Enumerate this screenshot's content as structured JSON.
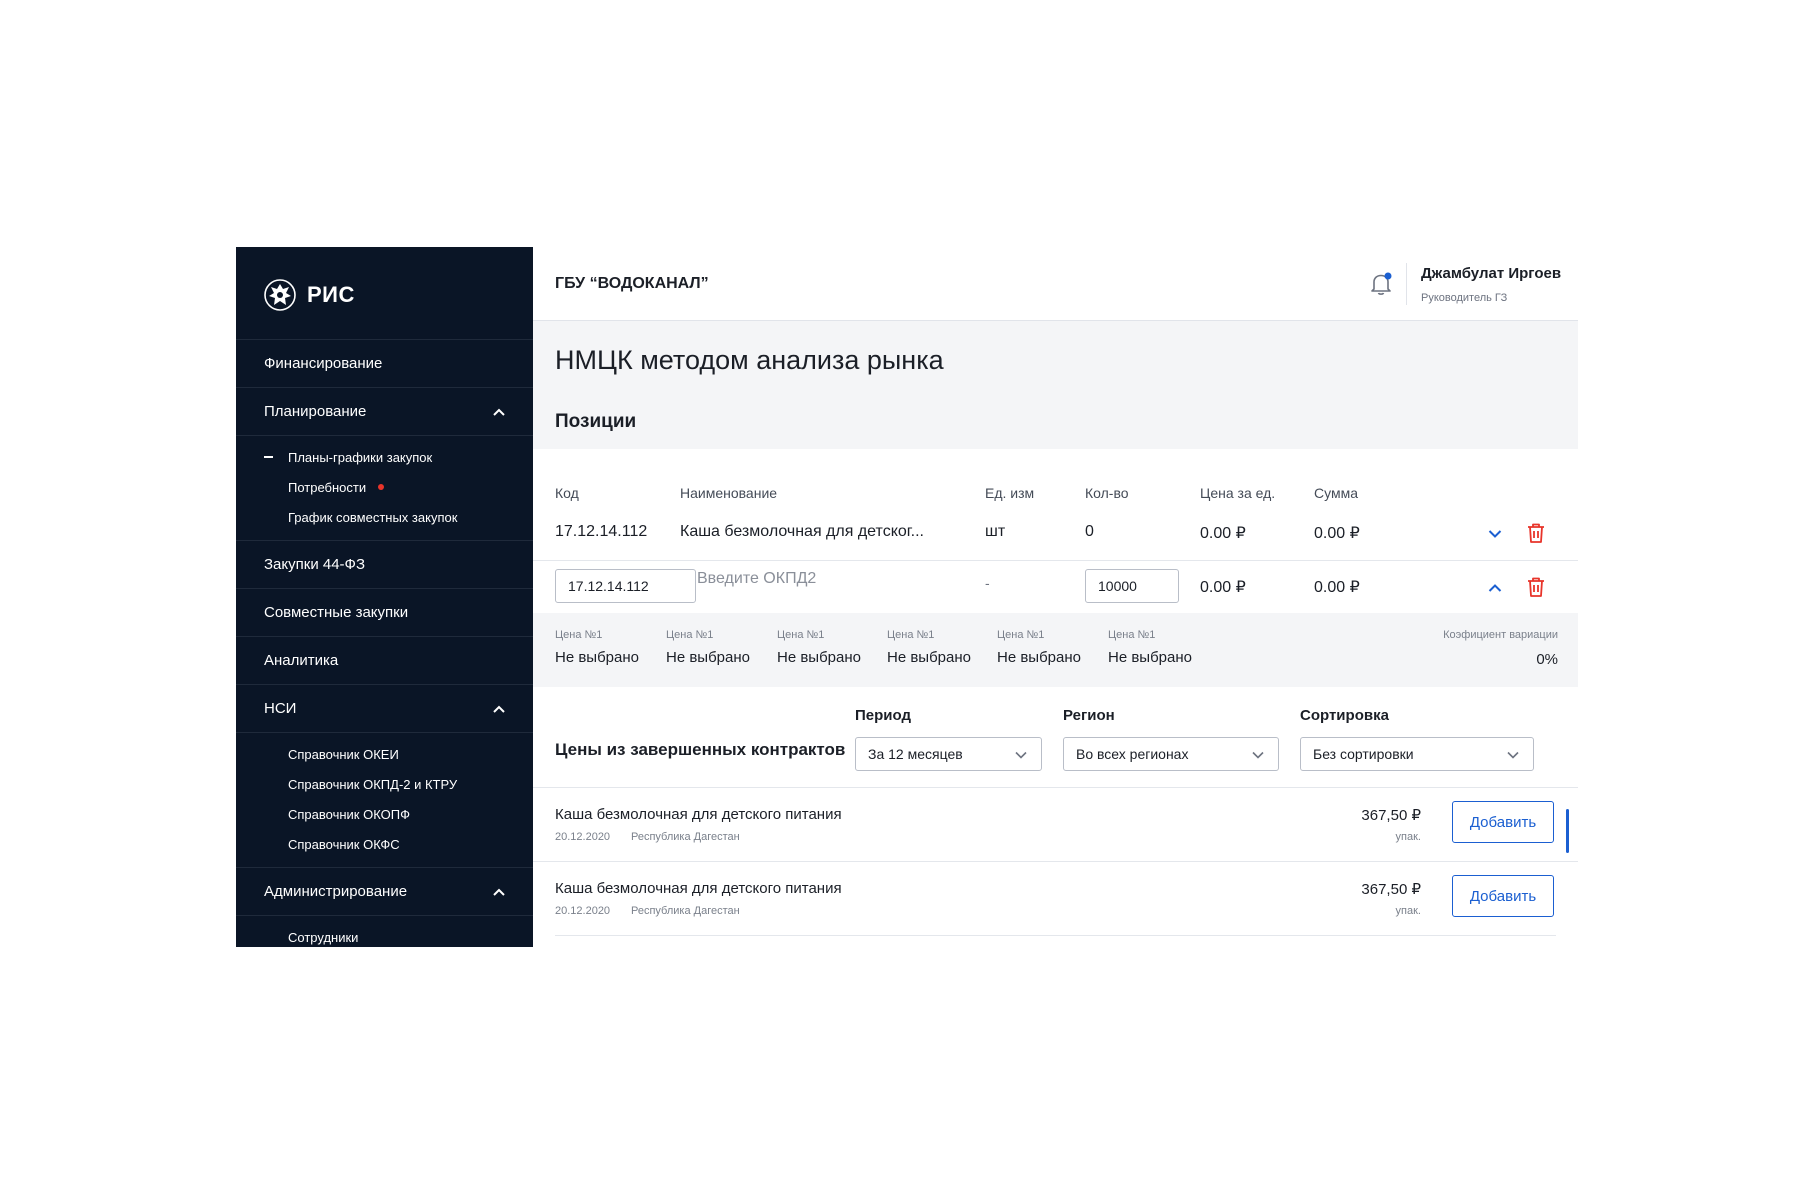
{
  "brand": {
    "name": "РИС"
  },
  "sidebar": {
    "items": [
      {
        "label": "Финансирование"
      },
      {
        "label": "Планирование",
        "expanded": true,
        "children": [
          {
            "label": "Планы-графики закупок",
            "active": true
          },
          {
            "label": "Потребности",
            "badge": true
          },
          {
            "label": "График совместных закупок"
          }
        ]
      },
      {
        "label": "Закупки 44-ФЗ"
      },
      {
        "label": "Совместные закупки"
      },
      {
        "label": "Аналитика"
      },
      {
        "label": "НСИ",
        "expanded": true,
        "children": [
          {
            "label": "Справочник ОКЕИ"
          },
          {
            "label": "Справочник ОКПД-2 и КТРУ"
          },
          {
            "label": "Справочник ОКОПФ"
          },
          {
            "label": "Справочник ОКФС"
          }
        ]
      },
      {
        "label": "Администрирование",
        "expanded": true,
        "children": [
          {
            "label": "Сотрудники"
          }
        ]
      }
    ]
  },
  "header": {
    "org": "ГБУ “ВОДОКАНАЛ”",
    "user": {
      "name": "Джамбулат Иргоев",
      "role": "Руководитель ГЗ"
    }
  },
  "page": {
    "title": "НМЦК методом анализа рынка",
    "section": "Позиции"
  },
  "table": {
    "columns": [
      "Код",
      "Наименование",
      "Ед. изм",
      "Кол-во",
      "Цена за ед.",
      "Сумма"
    ],
    "row": {
      "code": "17.12.14.112",
      "name": "Каша безмолочная для детског...",
      "unit": "шт",
      "qty": "0",
      "price": "0.00 ₽",
      "sum": "0.00 ₽"
    },
    "edit_row": {
      "code": "17.12.14.112",
      "name_placeholder": "Введите ОКПД2",
      "unit": "-",
      "qty": "10000",
      "price": "0.00 ₽",
      "sum": "0.00 ₽"
    }
  },
  "prices": {
    "items": [
      {
        "label": "Цена №1",
        "value": "Не выбрано"
      },
      {
        "label": "Цена №1",
        "value": "Не выбрано"
      },
      {
        "label": "Цена №1",
        "value": "Не выбрано"
      },
      {
        "label": "Цена №1",
        "value": "Не выбрано"
      },
      {
        "label": "Цена №1",
        "value": "Не выбрано"
      },
      {
        "label": "Цена №1",
        "value": "Не выбрано"
      }
    ],
    "coef_label": "Коэфициент вариации",
    "coef_value": "0%"
  },
  "filters": {
    "title": "Цены из завершенных контрактов",
    "period": {
      "label": "Период",
      "value": "За 12 месяцев"
    },
    "region": {
      "label": "Регион",
      "value": "Во всех регионах"
    },
    "sort": {
      "label": "Сортировка",
      "value": "Без сортировки"
    }
  },
  "results": [
    {
      "name": "Каша безмолочная для детского питания",
      "date": "20.12.2020",
      "region": "Республика Дагестан",
      "price": "367,50 ₽",
      "unit": "упак.",
      "button": "Добавить"
    },
    {
      "name": "Каша безмолочная для детского питания",
      "date": "20.12.2020",
      "region": "Республика Дагестан",
      "price": "367,50 ₽",
      "unit": "упак.",
      "button": "Добавить"
    }
  ],
  "colors": {
    "sidebar_bg": "#0a1526",
    "accent": "#1b5fd1",
    "danger": "#e8342a",
    "band_bg": "#f4f5f7"
  },
  "icons": [
    "emblem-icon",
    "chevron-up-icon",
    "bell-icon",
    "chevron-down-icon",
    "trash-icon"
  ]
}
